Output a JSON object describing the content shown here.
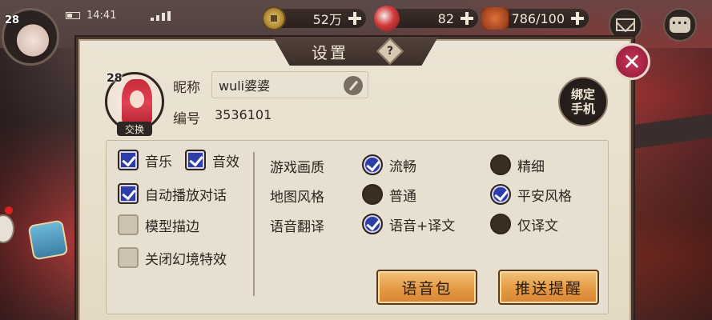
{
  "hud": {
    "level": "28",
    "time": "14:41",
    "coins": "52万",
    "jade": "82",
    "stamina": "786/100",
    "icons": [
      "coin-icon",
      "jade-icon",
      "stamina-icon",
      "mail-icon",
      "chat-icon"
    ]
  },
  "dialog": {
    "title": "设置",
    "help_glyph": "?",
    "close_glyph": "✕"
  },
  "profile": {
    "level": "28",
    "swap_label": "交换",
    "name_label": "昵称",
    "name_value": "wuli婆婆",
    "id_label": "编号",
    "id_value": "3536101",
    "bind_phone": "绑定手机"
  },
  "left_options": [
    {
      "label": "音乐",
      "checked": true
    },
    {
      "label": "音效",
      "checked": true
    },
    {
      "label": "自动播放对话",
      "checked": true
    },
    {
      "label": "模型描边",
      "checked": false
    },
    {
      "label": "关闭幻境特效",
      "checked": false
    }
  ],
  "right_settings": [
    {
      "label": "游戏画质",
      "options": [
        {
          "label": "流畅",
          "selected": true
        },
        {
          "label": "精细",
          "selected": false
        }
      ]
    },
    {
      "label": "地图风格",
      "options": [
        {
          "label": "普通",
          "selected": false
        },
        {
          "label": "平安风格",
          "selected": true
        }
      ]
    },
    {
      "label": "语音翻译",
      "options": [
        {
          "label": "语音+译文",
          "selected": true
        },
        {
          "label": "仅译文",
          "selected": false
        }
      ]
    }
  ],
  "buttons": {
    "voice_pack": "语音包",
    "push_notify": "推送提醒"
  },
  "colors": {
    "accent_checked": "#2e3ea8",
    "dialog_bg": "#ece4d4",
    "close_button": "#c7375c",
    "action_button": "#e39a43"
  }
}
